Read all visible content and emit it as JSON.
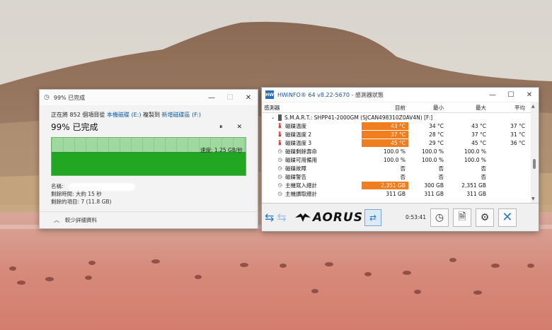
{
  "copy_dialog": {
    "title": "99% 已完成",
    "line_prefix": "正在將 852 個項目從",
    "source": "本機磁碟 (E:)",
    "line_mid": "複製到",
    "dest": "新增磁碟區 (F:)",
    "percent_title": "99% 已完成",
    "pause_glyph": "⏸",
    "cancel_glyph": "✕",
    "speed_label": "速度: 1.25 GB/秒",
    "name_label": "名稱:",
    "time_remaining": "剩餘時間: 大約 15 秒",
    "items_remaining": "剩餘的項目: 7 (11.8 GB)",
    "less_details": "較少詳細資料",
    "progress_fraction": 0.99
  },
  "hwinfo": {
    "title_app": "HWiNFO® 64 v8.22-5670 - ",
    "title_zh": "感測器狀態",
    "columns": {
      "name": "感測器",
      "current": "目前",
      "min": "最小",
      "max": "最大",
      "avg": "平均"
    },
    "drive": "S.M.A.R.T.: SHPP41-2000GM (SJCAN498310Z0AV4N) [F:]",
    "rows": [
      {
        "name": "磁碟溫度",
        "icon": "thermometer-icon",
        "current": "43 °C",
        "min": "34 °C",
        "max": "43 °C",
        "avg": "37 °C",
        "highlight": true
      },
      {
        "name": "磁碟溫度 2",
        "icon": "thermometer-icon",
        "current": "37 °C",
        "min": "28 °C",
        "max": "37 °C",
        "avg": "31 °C",
        "highlight": true
      },
      {
        "name": "磁碟溫度 3",
        "icon": "thermometer-icon",
        "current": "45 °C",
        "min": "29 °C",
        "max": "45 °C",
        "avg": "36 °C",
        "highlight": true
      },
      {
        "name": "磁碟剩餘壽命",
        "icon": "clock-icon",
        "current": "100.0 %",
        "min": "100.0 %",
        "max": "100.0 %",
        "avg": "",
        "highlight": false
      },
      {
        "name": "磁碟可用備用",
        "icon": "clock-icon",
        "current": "100.0 %",
        "min": "100.0 %",
        "max": "100.0 %",
        "avg": "",
        "highlight": false
      },
      {
        "name": "磁碟故障",
        "icon": "clock-icon",
        "current": "否",
        "min": "否",
        "max": "否",
        "avg": "",
        "highlight": false
      },
      {
        "name": "磁碟警告",
        "icon": "clock-icon",
        "current": "否",
        "min": "否",
        "max": "否",
        "avg": "",
        "highlight": false
      },
      {
        "name": "主機寫入總計",
        "icon": "clock-icon",
        "current": "2,351 GB",
        "min": "300 GB",
        "max": "2,351 GB",
        "avg": "",
        "highlight": true
      },
      {
        "name": "主機讀取總計",
        "icon": "clock-icon",
        "current": "311 GB",
        "min": "311 GB",
        "max": "311 GB",
        "avg": "",
        "highlight": false
      }
    ],
    "brand": "AORUS",
    "timer": "0:53:41"
  },
  "colors": {
    "highlight": "#f07d1e",
    "progress_green": "#22a722",
    "link_blue": "#0b5cad"
  }
}
